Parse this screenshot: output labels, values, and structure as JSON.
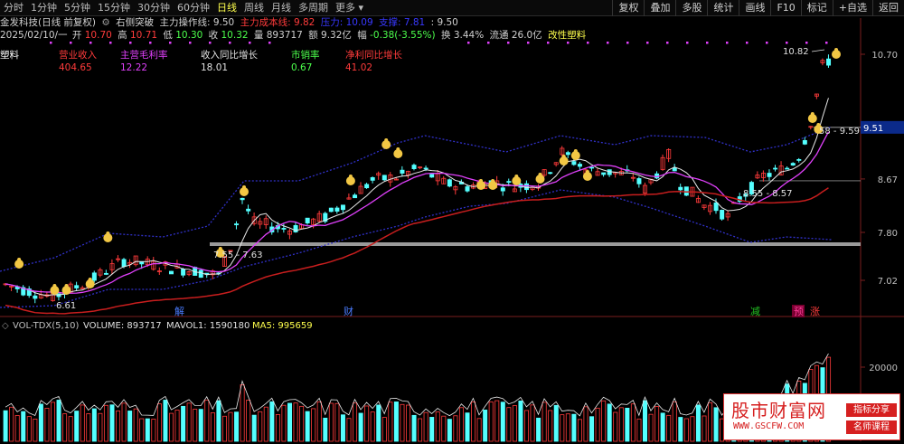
{
  "toolbar": {
    "tabs": [
      "分时",
      "1分钟",
      "5分钟",
      "15分钟",
      "30分钟",
      "60分钟",
      "日线",
      "周线",
      "月线",
      "多周期",
      "更多"
    ],
    "active_tab_index": 6,
    "right_buttons": [
      "复权",
      "叠加",
      "多股",
      "统计",
      "画线",
      "F10",
      "标记",
      "+自选",
      "返回"
    ]
  },
  "header": {
    "stock_title": "金发科技(日线 前复权)",
    "indicator": "右侧突破",
    "main_op": "主力操作线: 9.50",
    "cost_line": "主力成本线: 9.82",
    "support": "压力: 10.09",
    "resistance": "支撑: 7.81",
    "extra": ": 9.50"
  },
  "quote": {
    "date": "2025/02/10/一",
    "open_label": "开",
    "open": "10.70",
    "high_label": "高",
    "high": "10.71",
    "low_label": "低",
    "low": "10.30",
    "close_label": "收",
    "close": "10.32",
    "volume_label": "量",
    "volume": "893717",
    "amount_label": "额",
    "amount": "9.32亿",
    "change_label": "幅",
    "change": "-0.38(-3.55%)",
    "turnover_label": "换",
    "turnover": "3.44%",
    "float_label": "流通",
    "float": "26.0亿",
    "sector": "改性塑料"
  },
  "fundamentals": {
    "row_label": "塑料",
    "labels": [
      "营业收入",
      "主营毛利率",
      "收入同比增长",
      "市销率",
      "净利同比增长"
    ],
    "values": [
      "404.65",
      "12.22",
      "18.01",
      "0.67",
      "41.02"
    ],
    "colors": [
      "#ff3b3b",
      "#e040fb",
      "#e0e0e0",
      "#4cff4c",
      "#ff3b3b"
    ]
  },
  "price_axis": {
    "ticks": [
      "10.70",
      "9.51",
      "8.67",
      "7.80",
      "7.02"
    ],
    "current_price": "9.51"
  },
  "annotations": {
    "high_marker": "10.82",
    "low_marker": "6.61",
    "support_band_1": "7.55 - 7.63",
    "support_band_2": "8.55 - 8.57",
    "recent_band": "58 - 9.59",
    "event_jie": "解",
    "event_cai": "财",
    "event_jian": "减",
    "event_yu": "预",
    "event_zhang": "涨"
  },
  "volume_panel": {
    "title": "VOL-TDX(5,10)",
    "volume_text": "VOLUME: 893717",
    "mavol1_text": "MAVOL1: 1590180",
    "ma5_text": "MA5: 995659",
    "axis_tick": "20000"
  },
  "colors": {
    "up": "#ff3b3b",
    "down": "#54ffff",
    "ma_white": "#e8e8e8",
    "ma_magenta": "#e040fb",
    "ma_red": "#c81e1e",
    "ma_green": "#22c422",
    "band": "#3030c8",
    "accent_yellow": "#ffff4d"
  },
  "watermark": {
    "site_name": "股市财富网",
    "url": "WWW.GSCFW.COM",
    "tag1": "指标分享",
    "tag2": "名师课程"
  }
}
